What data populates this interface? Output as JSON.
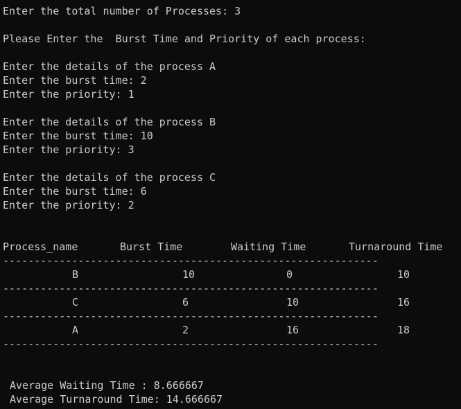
{
  "terminal": {
    "prompt_lines": [
      "Enter the total number of Processes: 3",
      "Please Enter the  Burst Time and Priority of each process:",
      "Enter the details of the process A",
      "Enter the burst time: 2",
      "Enter the priority: 1",
      "Enter the details of the process B",
      "Enter the burst time: 10",
      "Enter the priority: 3",
      "Enter the details of the process C",
      "Enter the burst time: 6",
      "Enter the priority: 2"
    ],
    "table": {
      "headers": [
        "Process_name",
        "Burst Time",
        "Waiting Time",
        "Turnaround Time"
      ],
      "separator": "------------------------------------------------------------",
      "rows": [
        {
          "name": "B",
          "burst": "10",
          "waiting": "0",
          "turnaround": "10"
        },
        {
          "name": "C",
          "burst": "6",
          "waiting": "10",
          "turnaround": "16"
        },
        {
          "name": "A",
          "burst": "2",
          "waiting": "16",
          "turnaround": "18"
        }
      ]
    },
    "summary": {
      "avg_waiting": "Average Waiting Time : 8.666667",
      "avg_turnaround": "Average Turnaround Time: 14.666667"
    }
  }
}
